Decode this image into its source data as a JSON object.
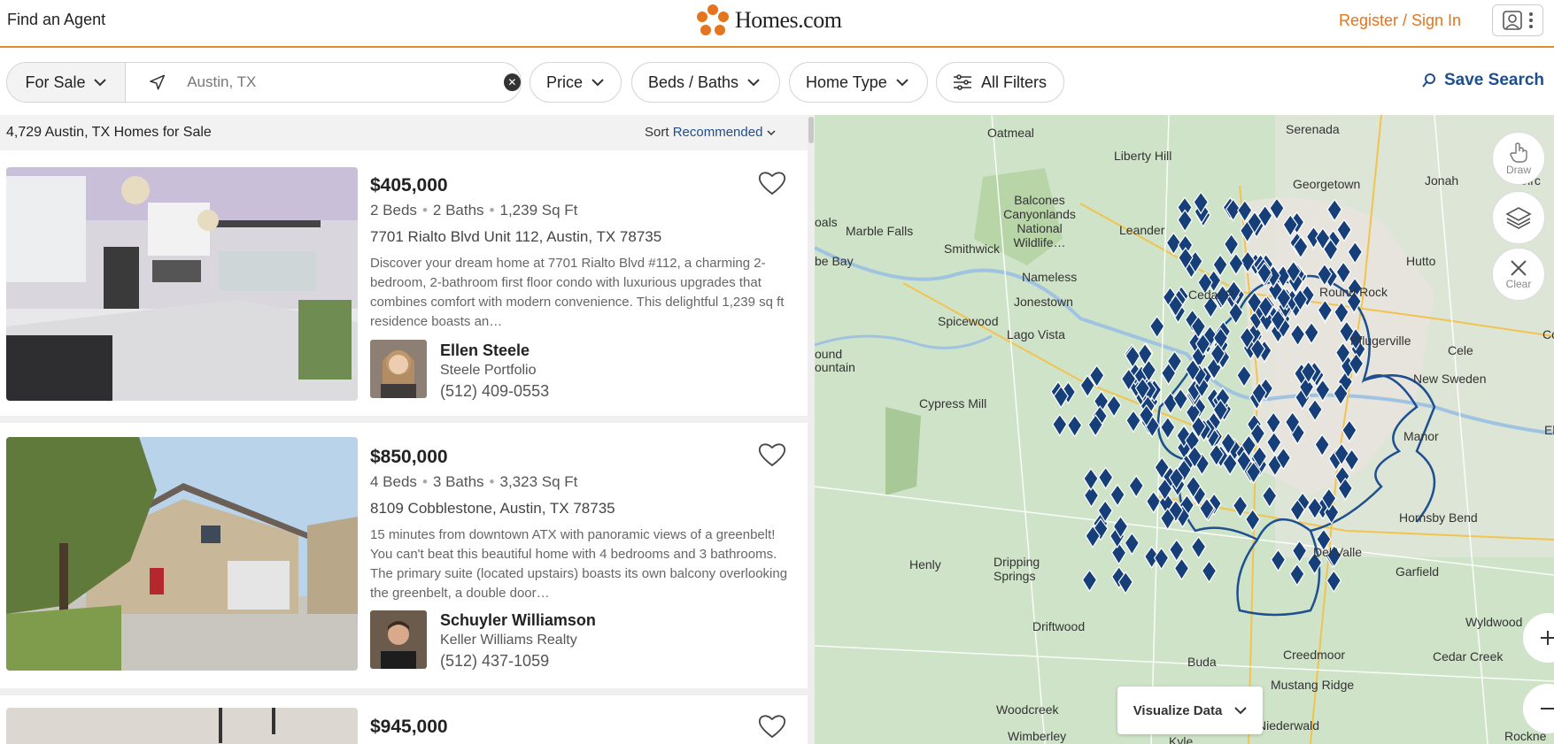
{
  "header": {
    "find_agent": "Find an Agent",
    "logo_text": "Homes.com",
    "register": "Register / Sign In"
  },
  "filters": {
    "listing_type": "For Sale",
    "search_value": "Austin, TX",
    "price": "Price",
    "beds_baths": "Beds / Baths",
    "home_type": "Home Type",
    "all_filters": "All Filters",
    "save_search": "Save Search"
  },
  "results": {
    "count_text": "4,729 Austin, TX Homes for Sale",
    "sort_label": "Sort",
    "sort_value": "Recommended"
  },
  "listings": [
    {
      "price": "$405,000",
      "beds": "2 Beds",
      "baths": "2 Baths",
      "sqft": "1,239 Sq Ft",
      "address": "7701 Rialto Blvd Unit 112, Austin, TX 78735",
      "description": "Discover your dream home at 7701 Rialto Blvd #112, a charming 2-bedroom, 2-bathroom first floor condo with luxurious upgrades that combines comfort with modern convenience. This delightful 1,239 sq ft residence boasts an…",
      "agent_name": "Ellen Steele",
      "agent_company": "Steele Portfolio",
      "agent_phone": "(512) 409-0553"
    },
    {
      "price": "$850,000",
      "beds": "4 Beds",
      "baths": "3 Baths",
      "sqft": "3,323 Sq Ft",
      "address": "8109 Cobblestone, Austin, TX 78735",
      "description": "15 minutes from downtown ATX with panoramic views of a greenbelt! You can't beat this beautiful home with 4 bedrooms and 3 bathrooms. The primary suite (located upstairs) boasts its own balcony overlooking the greenbelt, a double door…",
      "agent_name": "Schuyler Williamson",
      "agent_company": "Keller Williams Realty",
      "agent_phone": "(512) 437-1059"
    },
    {
      "price": "$945,000"
    }
  ],
  "map": {
    "labels": [
      "Oatmeal",
      "Serenada",
      "Liberty Hill",
      "Georgetown",
      "Jonah",
      "Circ",
      "Marble Falls",
      "Balcones Canyonlands National Wildlife…",
      "Leander",
      "Smithwick",
      "oals",
      "be Bay",
      "Hutto",
      "Nameless",
      "Cedar P",
      "Round Rock",
      "Jonestown",
      "Spicewood",
      "Lago Vista",
      "Pflugerville",
      "Cele",
      "Coupla",
      "ound",
      "ountain",
      "New Sweden",
      "Cypress Mill",
      "Manor",
      "El",
      "Hornsby Bend",
      "Henly",
      "Dripping Springs",
      "Garfield",
      "Del Valle",
      "Driftwood",
      "Wyldwood",
      "Creedmoor",
      "Cedar Creek",
      "Buda",
      "Mustang Ridge",
      "Woodcreek",
      "Niederwald",
      "Wimberley",
      "Kyle",
      "Rockne"
    ],
    "draw_label": "Draw",
    "clear_label": "Clear",
    "visualize": "Visualize Data"
  },
  "colors": {
    "accent_orange": "#e5741f",
    "link_blue": "#1f4e8c",
    "marker_blue": "#163f7a",
    "map_green": "#cfe3c8"
  }
}
